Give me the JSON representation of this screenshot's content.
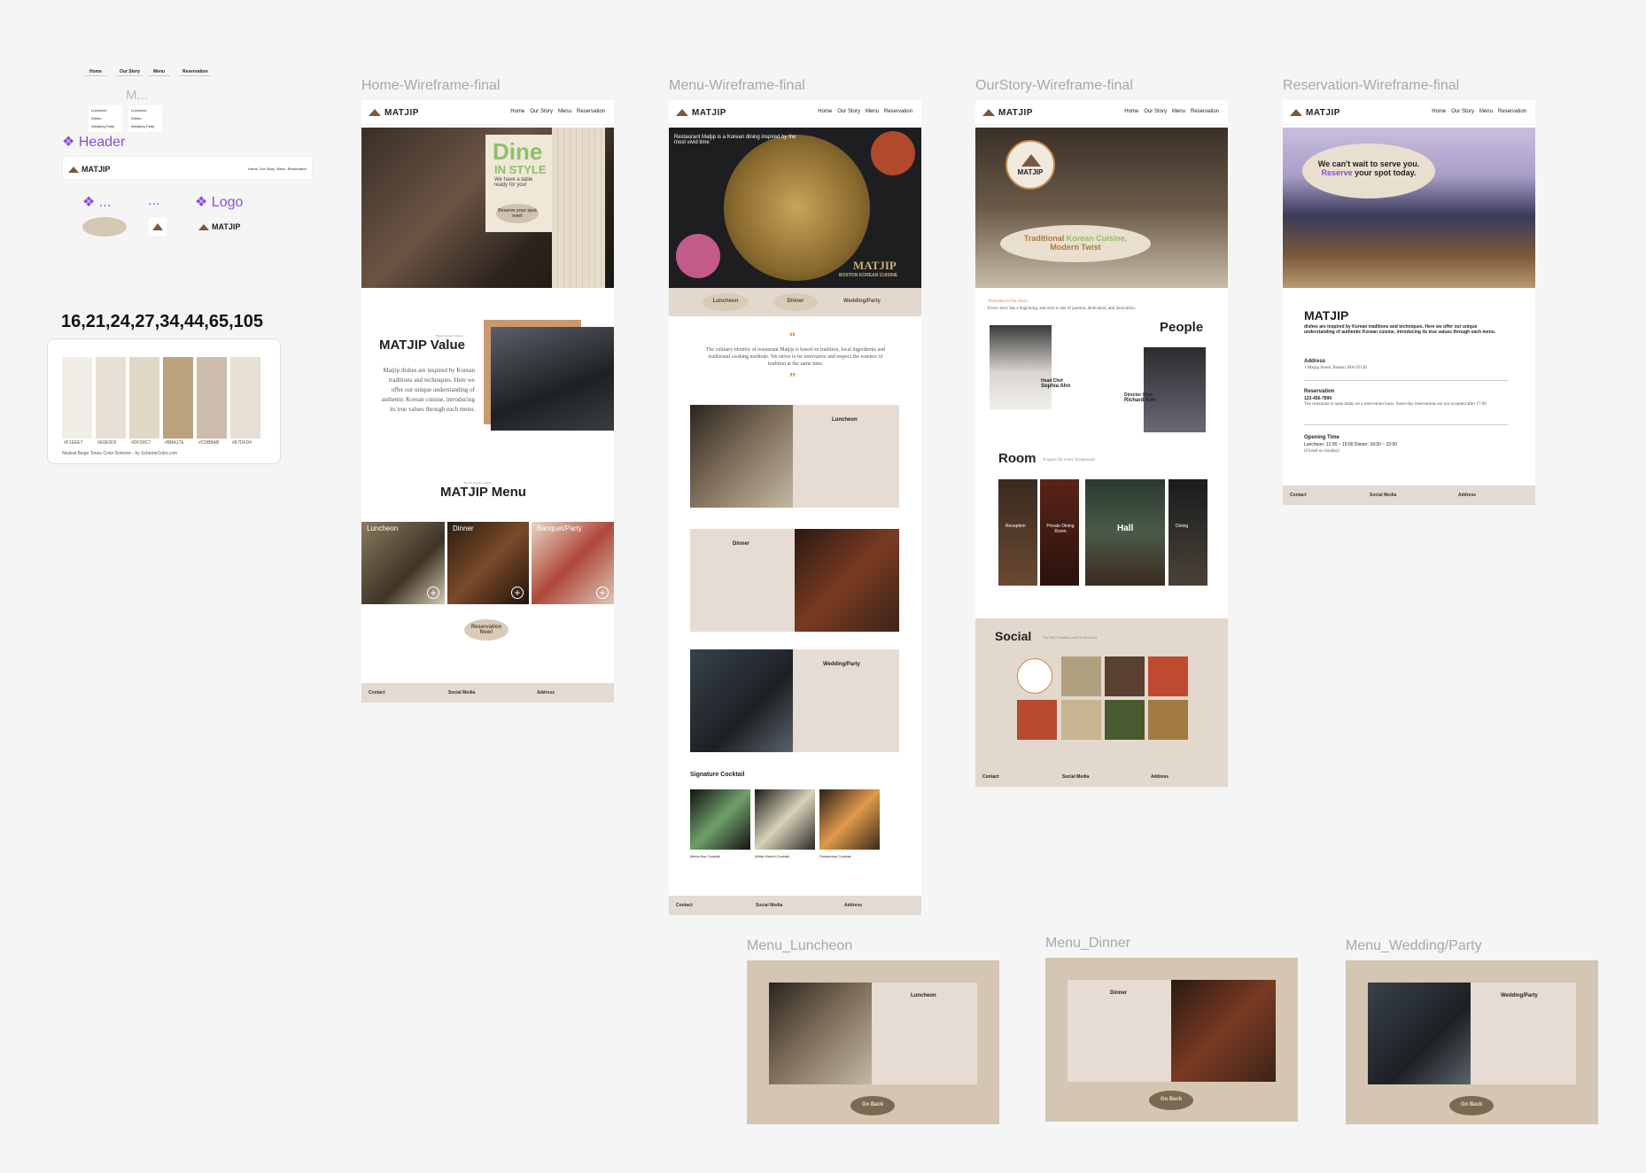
{
  "components": {
    "nav_items": [
      "Home",
      "Our Story",
      "Menu",
      "Reservation"
    ],
    "m_label": "M...",
    "dropdown_items": [
      "Luncheon",
      "Dinner",
      "Wedding Party"
    ],
    "header_label": "Header",
    "dots1": "...",
    "dots2": "...",
    "logo_label": "Logo",
    "logo_text": "MATJIP"
  },
  "palette": {
    "title": "16,21,24,27,34,44,65,105",
    "swatches": [
      {
        "hex": "#F1EEE7",
        "label": "#F1EEE7"
      },
      {
        "hex": "#E6E0D5",
        "label": "#E6E0D5"
      },
      {
        "hex": "#DFD8C7",
        "label": "#DFD8C7"
      },
      {
        "hex": "#BBA17E",
        "label": "#BBA17E"
      },
      {
        "hex": "#CDBBAB",
        "label": "#CDBBAB"
      },
      {
        "hex": "#E7DFD4",
        "label": "#E7DFD4"
      }
    ],
    "caption": "Neutral Beige Tones  Color Scheme - by SchemeColor.com"
  },
  "frames": {
    "home": {
      "label": "Home-Wireframe-final",
      "hero_title1": "Dine",
      "hero_title2": "IN STYLE",
      "hero_sub": "We have a table ready for you!",
      "hero_btn": "Reserve your spot now!",
      "value_kicker": "Boston Korean Cuisine",
      "value_title": "MATJIP Value",
      "value_text": "Matjip dishes are inspired by Korean traditions and techniques. Here we offer our unique understanding of authentic Korean cuisine, introducing its true values through each menu.",
      "menu_kicker": "Boston Korean Cuisine",
      "menu_title": "MATJIP Menu",
      "tiles": [
        "Luncheon",
        "Dinner",
        "Banquet/Party"
      ],
      "reserve_btn": "Reservation Now!",
      "footer": {
        "contact": "Contact",
        "social": "Social Media",
        "address": "Address"
      }
    },
    "menu": {
      "label": "Menu-Wireframe-final",
      "hero_text": "Restaurant Matjip is a Korean dining inspired by the most vivid time",
      "hero_logo": "MATJIP",
      "hero_sub": "BOSTON KOREAN CUISINE",
      "pills": [
        "Luncheon",
        "Dinner",
        "Wedding/Party"
      ],
      "quote_open": "“",
      "quote_close": "”",
      "quote_text": "The culinary identity of restaurant Matjip is based on tradition, local ingredients and traditional cooking methods. We strive to be innovative and respect the essence of tradition at the same time.",
      "sections": [
        "Luncheon",
        "Dinner",
        "Wedding/Party"
      ],
      "sig_title": "Signature Cocktail",
      "cocktails": [
        "Melon Bar Cocktail",
        "White Kimchi Cocktail",
        "Persimmon Cocktail"
      ],
      "footer": {
        "contact": "Contact",
        "social": "Social Media",
        "address": "Address"
      }
    },
    "story": {
      "label": "OurStory-Wireframe-final",
      "hero_logo": "MATJIP",
      "hero_t1": "Traditional",
      "hero_t2": "Korean Cuisine,",
      "hero_t3": "Modern Twist",
      "welcome": "Welcome to Our Story",
      "intro": "Every story has a beginning, and ours is one of passion, dedication, and innovation.",
      "people_title": "People",
      "chef1_role": "Head Chef",
      "chef1_name": "Sophia Ahn",
      "chef2_role": "Director Chef",
      "chef2_name": "Richard Kim",
      "room_title": "Room",
      "room_sub": "A space for every foreground",
      "rooms": [
        "Reception",
        "Private Dining Room",
        "Hall",
        "Dining"
      ],
      "social_title": "Social",
      "social_sub": "Our Way's Tradition and Get Involved",
      "footer": {
        "contact": "Contact",
        "social": "Social Media",
        "address": "Address"
      }
    },
    "reservation": {
      "label": "Reservation-Wireframe-final",
      "bubble1": "We can't wait to serve you.",
      "bubble_hl": "Reserve",
      "bubble2": "your spot today.",
      "title": "MATJIP",
      "intro": "dishes are inspired by Korean traditions and techniques. Here we offer our unique understanding of authentic Korean cuisine, introducing its true values through each menu.",
      "address_h": "Address",
      "address_v": "1 Matjip Street, Boston, MA 02138",
      "res_h": "Reservation",
      "res_phone": "123-456-7890",
      "res_note": "The restaurant is open today on a reservation basis. Same-day reservations are not accepted after 17:00",
      "open_h": "Opening Time",
      "open_v": "Luncheon: 12:00 ~ 15:00   Dinner: 18:00 ~ 22:00",
      "closed": "(Closed on Sunday)",
      "footer": {
        "contact": "Contact",
        "social": "Social Media",
        "address": "Address"
      }
    },
    "luncheon": {
      "label": "Menu_Luncheon",
      "title": "Luncheon",
      "btn": "Go Back"
    },
    "dinner": {
      "label": "Menu_Dinner",
      "title": "Dinner",
      "btn": "Go Back"
    },
    "wedding": {
      "label": "Menu_Wedding/Party",
      "title": "Wedding/Party",
      "btn": "Go Back"
    }
  }
}
